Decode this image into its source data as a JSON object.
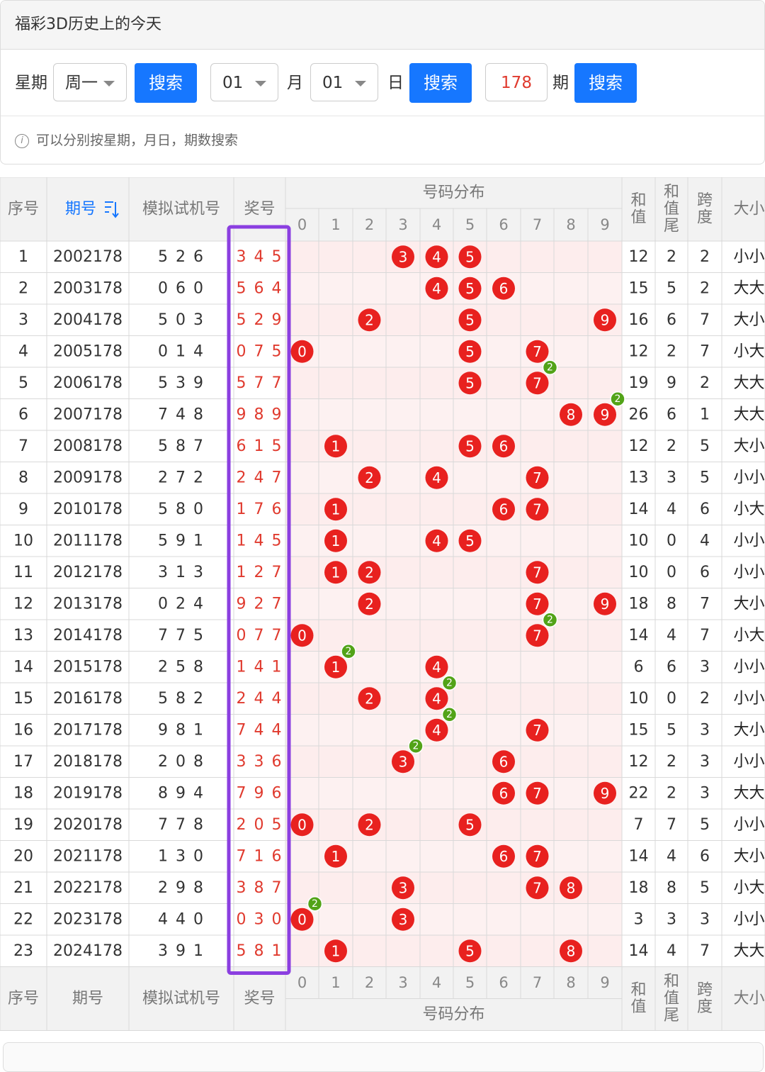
{
  "header": {
    "title": "福彩3D历史上的今天"
  },
  "search": {
    "week_label": "星期",
    "week_value": "周一",
    "search1": "搜索",
    "month_value": "01",
    "month_label": "月",
    "day_value": "01",
    "day_label": "日",
    "search2": "搜索",
    "period_value": "178",
    "period_label": "期",
    "search3": "搜索",
    "hint": "可以分别按星期，月日，期数搜索"
  },
  "table": {
    "headers": {
      "seq": "序号",
      "period": "期号",
      "sim": "模拟试机号",
      "award": "奖号",
      "dist": "号码分布",
      "sum": "和值",
      "sum_tail": "和值尾",
      "span": "跨度",
      "size": "大小"
    },
    "sort_icon": "sort-desc-icon",
    "digits": [
      "0",
      "1",
      "2",
      "3",
      "4",
      "5",
      "6",
      "7",
      "8",
      "9"
    ],
    "rows": [
      {
        "seq": "1",
        "period": "2002178",
        "sim": "5 2 6",
        "award": "3 4 5",
        "balls": [
          3,
          4,
          5
        ],
        "doubles": [],
        "sum": "12",
        "tail": "2",
        "span": "2",
        "size": "小小"
      },
      {
        "seq": "2",
        "period": "2003178",
        "sim": "0 6 0",
        "award": "5 6 4",
        "balls": [
          4,
          5,
          6
        ],
        "doubles": [],
        "sum": "15",
        "tail": "5",
        "span": "2",
        "size": "大大"
      },
      {
        "seq": "3",
        "period": "2004178",
        "sim": "5 0 3",
        "award": "5 2 9",
        "balls": [
          2,
          5,
          9
        ],
        "doubles": [],
        "sum": "16",
        "tail": "6",
        "span": "7",
        "size": "大小"
      },
      {
        "seq": "4",
        "period": "2005178",
        "sim": "0 1 4",
        "award": "0 7 5",
        "balls": [
          0,
          5,
          7
        ],
        "doubles": [],
        "sum": "12",
        "tail": "2",
        "span": "7",
        "size": "小大"
      },
      {
        "seq": "5",
        "period": "2006178",
        "sim": "5 3 9",
        "award": "5 7 7",
        "balls": [
          5,
          7
        ],
        "doubles": [
          7
        ],
        "sum": "19",
        "tail": "9",
        "span": "2",
        "size": "大大"
      },
      {
        "seq": "6",
        "period": "2007178",
        "sim": "7 4 8",
        "award": "9 8 9",
        "balls": [
          8,
          9
        ],
        "doubles": [
          9
        ],
        "sum": "26",
        "tail": "6",
        "span": "1",
        "size": "大大"
      },
      {
        "seq": "7",
        "period": "2008178",
        "sim": "5 8 7",
        "award": "6 1 5",
        "balls": [
          1,
          5,
          6
        ],
        "doubles": [],
        "sum": "12",
        "tail": "2",
        "span": "5",
        "size": "大小"
      },
      {
        "seq": "8",
        "period": "2009178",
        "sim": "2 7 2",
        "award": "2 4 7",
        "balls": [
          2,
          4,
          7
        ],
        "doubles": [],
        "sum": "13",
        "tail": "3",
        "span": "5",
        "size": "小小"
      },
      {
        "seq": "9",
        "period": "2010178",
        "sim": "5 8 0",
        "award": "1 7 6",
        "balls": [
          1,
          6,
          7
        ],
        "doubles": [],
        "sum": "14",
        "tail": "4",
        "span": "6",
        "size": "小大"
      },
      {
        "seq": "10",
        "period": "2011178",
        "sim": "5 9 1",
        "award": "1 4 5",
        "balls": [
          1,
          4,
          5
        ],
        "doubles": [],
        "sum": "10",
        "tail": "0",
        "span": "4",
        "size": "小小"
      },
      {
        "seq": "11",
        "period": "2012178",
        "sim": "3 1 3",
        "award": "1 2 7",
        "balls": [
          1,
          2,
          7
        ],
        "doubles": [],
        "sum": "10",
        "tail": "0",
        "span": "6",
        "size": "小小"
      },
      {
        "seq": "12",
        "period": "2013178",
        "sim": "0 2 4",
        "award": "9 2 7",
        "balls": [
          2,
          7,
          9
        ],
        "doubles": [],
        "sum": "18",
        "tail": "8",
        "span": "7",
        "size": "大小"
      },
      {
        "seq": "13",
        "period": "2014178",
        "sim": "7 7 5",
        "award": "0 7 7",
        "balls": [
          0,
          7
        ],
        "doubles": [
          7
        ],
        "sum": "14",
        "tail": "4",
        "span": "7",
        "size": "小大"
      },
      {
        "seq": "14",
        "period": "2015178",
        "sim": "2 5 8",
        "award": "1 4 1",
        "balls": [
          1,
          4
        ],
        "doubles": [
          1
        ],
        "sum": "6",
        "tail": "6",
        "span": "3",
        "size": "小小"
      },
      {
        "seq": "15",
        "period": "2016178",
        "sim": "5 8 2",
        "award": "2 4 4",
        "balls": [
          2,
          4
        ],
        "doubles": [
          4
        ],
        "sum": "10",
        "tail": "0",
        "span": "2",
        "size": "小小"
      },
      {
        "seq": "16",
        "period": "2017178",
        "sim": "9 8 1",
        "award": "7 4 4",
        "balls": [
          4,
          7
        ],
        "doubles": [
          4
        ],
        "sum": "15",
        "tail": "5",
        "span": "3",
        "size": "大小"
      },
      {
        "seq": "17",
        "period": "2018178",
        "sim": "2 0 8",
        "award": "3 3 6",
        "balls": [
          3,
          6
        ],
        "doubles": [
          3
        ],
        "sum": "12",
        "tail": "2",
        "span": "3",
        "size": "小小"
      },
      {
        "seq": "18",
        "period": "2019178",
        "sim": "8 9 4",
        "award": "7 9 6",
        "balls": [
          6,
          7,
          9
        ],
        "doubles": [],
        "sum": "22",
        "tail": "2",
        "span": "3",
        "size": "大大"
      },
      {
        "seq": "19",
        "period": "2020178",
        "sim": "7 7 8",
        "award": "2 0 5",
        "balls": [
          0,
          2,
          5
        ],
        "doubles": [],
        "sum": "7",
        "tail": "7",
        "span": "5",
        "size": "小小"
      },
      {
        "seq": "20",
        "period": "2021178",
        "sim": "1 3 0",
        "award": "7 1 6",
        "balls": [
          1,
          6,
          7
        ],
        "doubles": [],
        "sum": "14",
        "tail": "4",
        "span": "6",
        "size": "大小"
      },
      {
        "seq": "21",
        "period": "2022178",
        "sim": "2 9 8",
        "award": "3 8 7",
        "balls": [
          3,
          7,
          8
        ],
        "doubles": [],
        "sum": "18",
        "tail": "8",
        "span": "5",
        "size": "小大"
      },
      {
        "seq": "22",
        "period": "2023178",
        "sim": "4 4 0",
        "award": "0 3 0",
        "balls": [
          0,
          3
        ],
        "doubles": [
          0
        ],
        "sum": "3",
        "tail": "3",
        "span": "3",
        "size": "小小"
      },
      {
        "seq": "23",
        "period": "2024178",
        "sim": "3 9 1",
        "award": "5 8 1",
        "balls": [
          1,
          5,
          8
        ],
        "doubles": [],
        "sum": "14",
        "tail": "4",
        "span": "7",
        "size": "大大"
      }
    ],
    "double_mark": "2"
  },
  "colors": {
    "ball": "#e8211f",
    "double": "#52a318",
    "highlight": "#8b3fe0",
    "award_text": "#e03a2e",
    "period_link": "#1677ff"
  }
}
